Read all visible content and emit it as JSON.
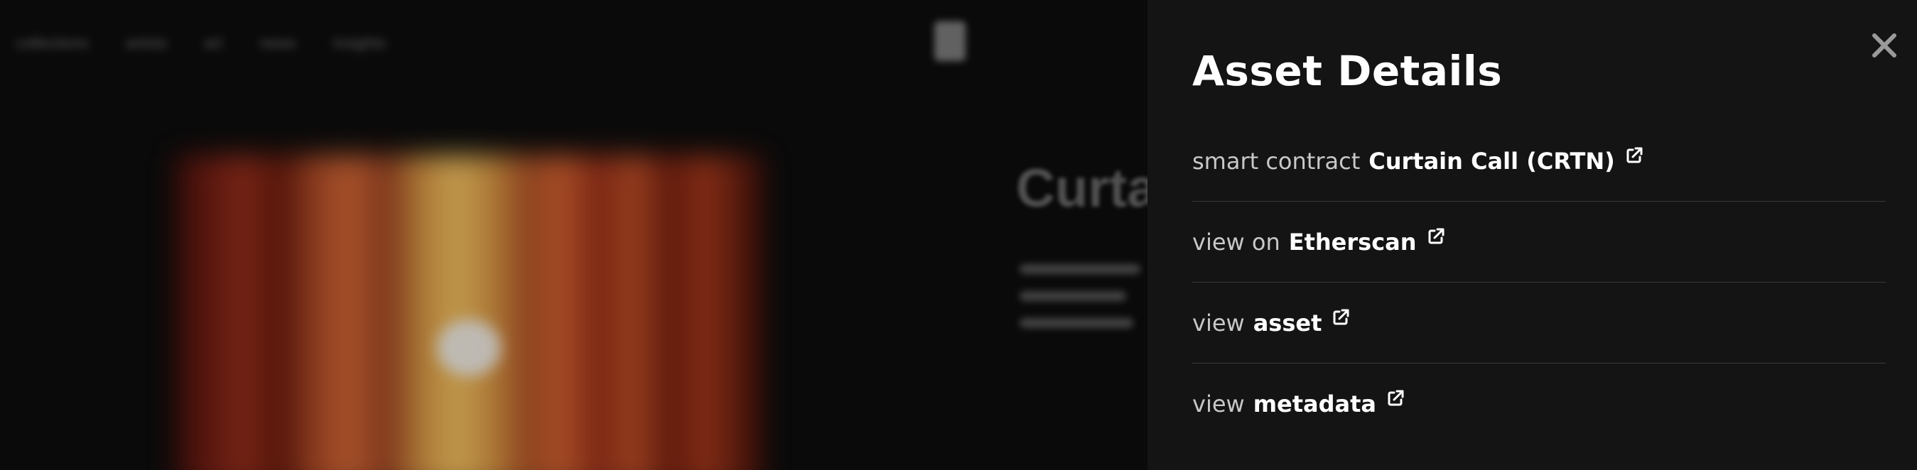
{
  "background": {
    "nav_items": [
      "collections",
      "artists",
      "art",
      "news",
      "insights"
    ],
    "artwork_title": "Curta"
  },
  "drawer": {
    "title": "Asset Details",
    "close_icon": "close-icon",
    "rows": [
      {
        "prefix": "smart contract",
        "link": "Curtain Call (CRTN)",
        "icon": "external-link-icon"
      },
      {
        "prefix": "view on",
        "link": "Etherscan",
        "icon": "external-link-icon"
      },
      {
        "prefix": "view",
        "link": "asset",
        "icon": "external-link-icon"
      },
      {
        "prefix": "view",
        "link": "metadata",
        "icon": "external-link-icon"
      }
    ]
  },
  "colors": {
    "drawer_background": "#141414",
    "overlay_background": "#0a0a0a",
    "text_primary": "#ffffff",
    "text_secondary": "#c8c8c8",
    "divider": "#3a3a3a",
    "close_icon": "#9a9a9a"
  }
}
